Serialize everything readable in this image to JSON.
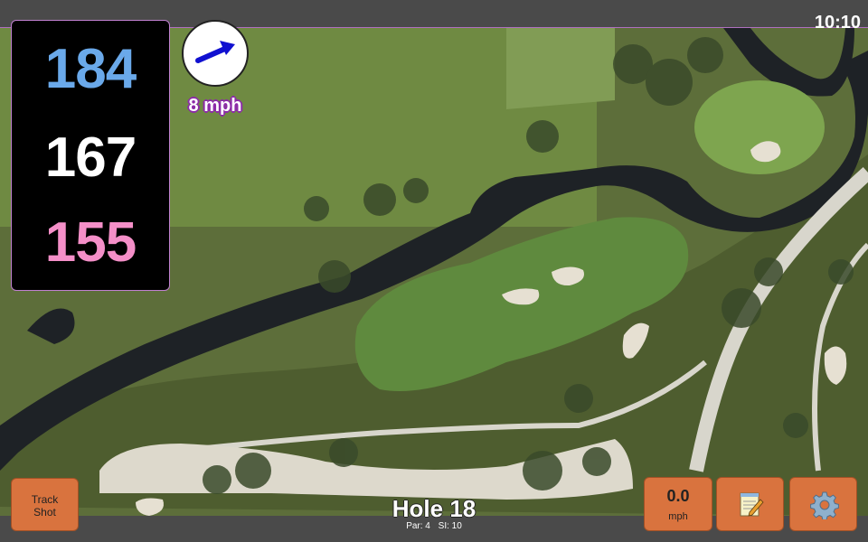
{
  "status": {
    "time": "10:10"
  },
  "yardages": {
    "back": "184",
    "center": "167",
    "front": "155"
  },
  "wind": {
    "speed": "8 mph",
    "icon": "arrow-icon"
  },
  "hole": {
    "title": "Hole 18",
    "par": "Par: 4",
    "stroke_index": "SI: 10"
  },
  "buttons": {
    "track_shot_line1": "Track",
    "track_shot_line2": "Shot",
    "speed_value": "0.0",
    "speed_unit": "mph",
    "notes_icon": "notepad-icon",
    "settings_icon": "gear-icon"
  },
  "colors": {
    "back_yardage": "#6aa9ea",
    "center_yardage": "#ffffff",
    "front_yardage": "#f48fc8",
    "button": "#d9733e",
    "wind_arrow": "#1010d0"
  }
}
